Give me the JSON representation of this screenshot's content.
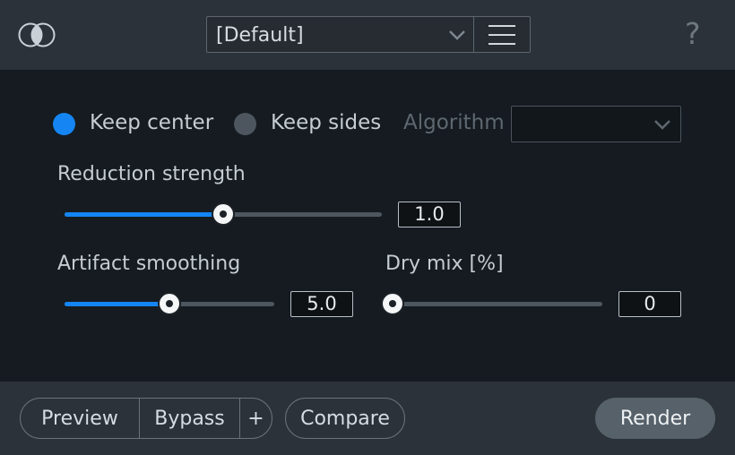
{
  "header": {
    "logo_icon": "overlapping-circles-icon",
    "preset": {
      "selected": "[Default]",
      "chevron_icon": "chevron-down-icon"
    },
    "menu_icon": "hamburger-icon",
    "help_label": "?"
  },
  "controls": {
    "mode": {
      "options": [
        {
          "label": "Keep center",
          "selected": true
        },
        {
          "label": "Keep sides",
          "selected": false
        }
      ]
    },
    "algorithm": {
      "label": "Algorithm",
      "value": "",
      "disabled": true
    },
    "reduction_strength": {
      "label": "Reduction strength",
      "value": "1.0",
      "fill_fraction": 0.5
    },
    "artifact_smoothing": {
      "label": "Artifact smoothing",
      "value": "5.0",
      "fill_fraction": 0.5
    },
    "dry_mix": {
      "label": "Dry mix [%]",
      "value": "0",
      "fill_fraction": 0.0
    }
  },
  "footer": {
    "preview_label": "Preview",
    "bypass_label": "Bypass",
    "add_label": "+",
    "compare_label": "Compare",
    "render_label": "Render"
  },
  "colors": {
    "accent": "#1485f3",
    "header_bg": "#2b3239",
    "panel_bg": "#151b20",
    "render_bg": "#56616a"
  }
}
